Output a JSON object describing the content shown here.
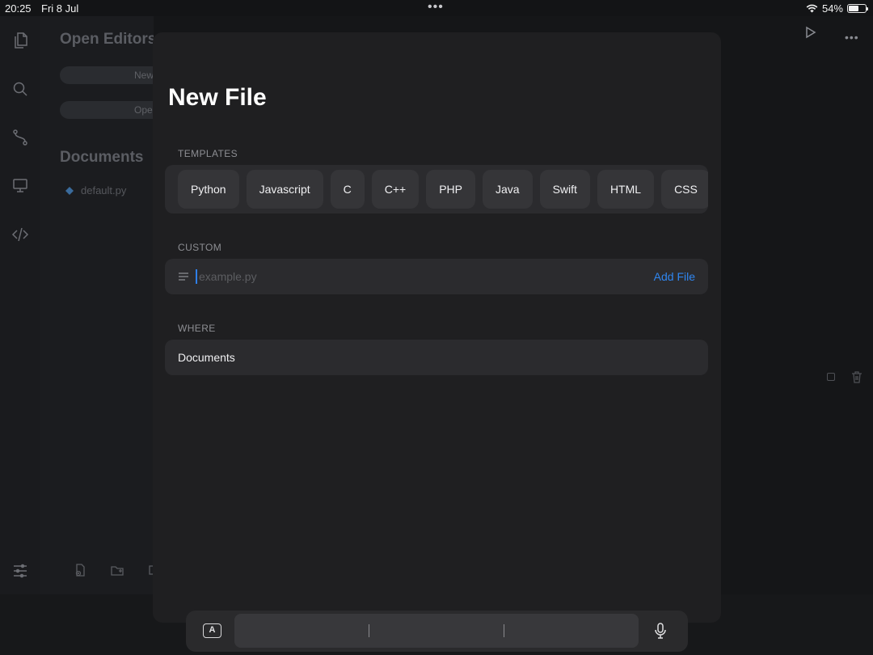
{
  "status_bar": {
    "time": "20:25",
    "date": "Fri 8 Jul",
    "battery": "54%"
  },
  "sidebar": {
    "open_editors_title": "Open Editors",
    "buttons": [
      "New",
      "Open"
    ],
    "documents_title": "Documents",
    "files": [
      {
        "name": "default.py",
        "icon": "python-icon"
      }
    ]
  },
  "sheet": {
    "title": "New File",
    "templates_label": "TEMPLATES",
    "templates": [
      "Python",
      "Javascript",
      "C",
      "C++",
      "PHP",
      "Java",
      "Swift",
      "HTML",
      "CSS"
    ],
    "custom_label": "CUSTOM",
    "custom_input": {
      "value": "",
      "placeholder": "example.py"
    },
    "add_file_label": "Add File",
    "where_label": "WHERE",
    "where_value": "Documents"
  },
  "keyboard": {
    "key_label": "A"
  }
}
